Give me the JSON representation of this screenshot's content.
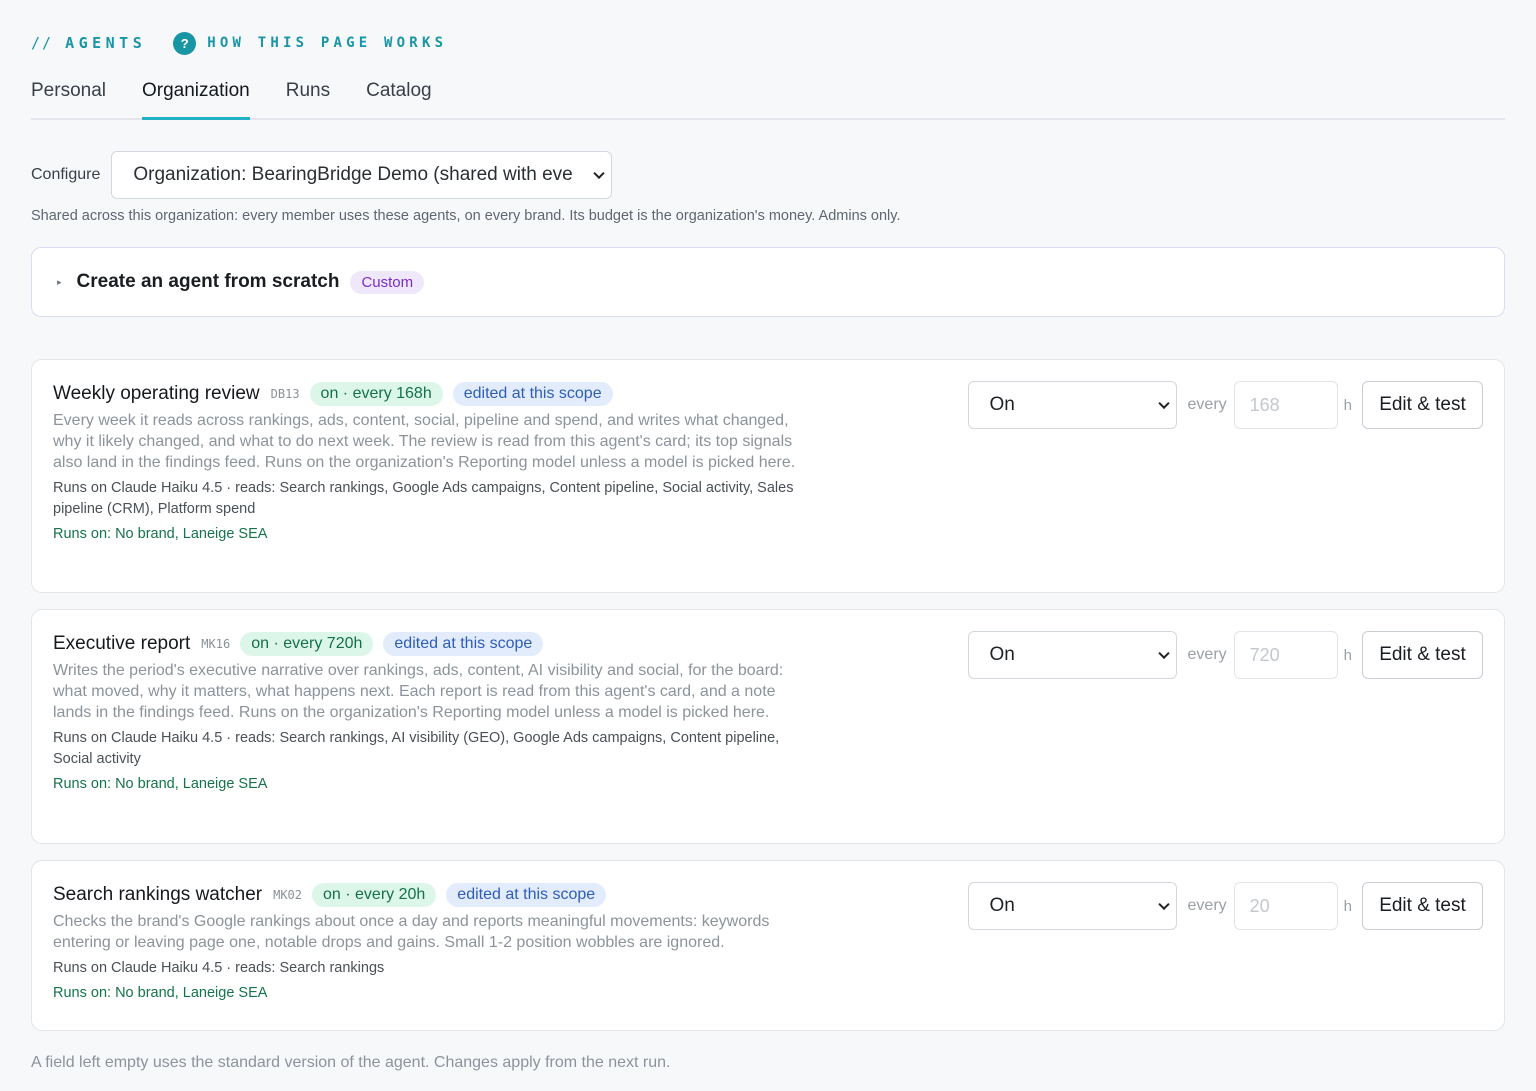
{
  "header": {
    "slashes": "//",
    "section": "AGENTS",
    "help_icon": "?",
    "help_link": "HOW THIS PAGE WORKS"
  },
  "tabs": [
    {
      "label": "Personal",
      "active": false
    },
    {
      "label": "Organization",
      "active": true
    },
    {
      "label": "Runs",
      "active": false
    },
    {
      "label": "Catalog",
      "active": false
    }
  ],
  "configure": {
    "label": "Configure",
    "selected": "Organization: BearingBridge Demo (shared with eve",
    "note": "Shared across this organization: every member uses these agents, on every brand. Its budget is the organization's money. Admins only."
  },
  "create": {
    "caret": "▸",
    "title": "Create an agent from scratch",
    "badge": "Custom"
  },
  "agents": [
    {
      "title": "Weekly operating review",
      "code": "DB13",
      "status_pill": "on · every 168h",
      "scope_pill": "edited at this scope",
      "description": "Every week it reads across rankings, ads, content, social, pipeline and spend, and writes what changed, why it likely changed, and what to do next week. The review is read from this agent's card; its top signals also land in the findings feed. Runs on the organization's Reporting model unless a model is picked here.",
      "reads": "Runs on Claude Haiku 4.5 · reads: Search rankings, Google Ads campaigns, Content pipeline, Social activity, Sales pipeline (CRM), Platform spend",
      "runs_on": "Runs on: No brand, Laneige SEA",
      "state": "On",
      "every_label": "every",
      "interval_placeholder": "168",
      "unit": "h",
      "edit_label": "Edit & test"
    },
    {
      "title": "Executive report",
      "code": "MK16",
      "status_pill": "on · every 720h",
      "scope_pill": "edited at this scope",
      "description": "Writes the period's executive narrative over rankings, ads, content, AI visibility and social, for the board: what moved, why it matters, what happens next. Each report is read from this agent's card, and a note lands in the findings feed. Runs on the organization's Reporting model unless a model is picked here.",
      "reads": "Runs on Claude Haiku 4.5 · reads: Search rankings, AI visibility (GEO), Google Ads campaigns, Content pipeline, Social activity",
      "runs_on": "Runs on: No brand, Laneige SEA",
      "state": "On",
      "every_label": "every",
      "interval_placeholder": "720",
      "unit": "h",
      "edit_label": "Edit & test"
    },
    {
      "title": "Search rankings watcher",
      "code": "MK02",
      "status_pill": "on · every 20h",
      "scope_pill": "edited at this scope",
      "description": "Checks the brand's Google rankings about once a day and reports meaningful movements: keywords entering or leaving page one, notable drops and gains. Small 1-2 position wobbles are ignored.",
      "reads": "Runs on Claude Haiku 4.5 · reads: Search rankings",
      "runs_on": "Runs on: No brand, Laneige SEA",
      "state": "On",
      "every_label": "every",
      "interval_placeholder": "20",
      "unit": "h",
      "edit_label": "Edit & test"
    }
  ],
  "footer": "A field left empty uses the standard version of the agent. Changes apply from the next run.",
  "colors": {
    "accent": "#1996a6",
    "tab_underline": "#22b0c4",
    "runs_on_green": "#16734b",
    "custom_purple": "#7a2dc4"
  }
}
